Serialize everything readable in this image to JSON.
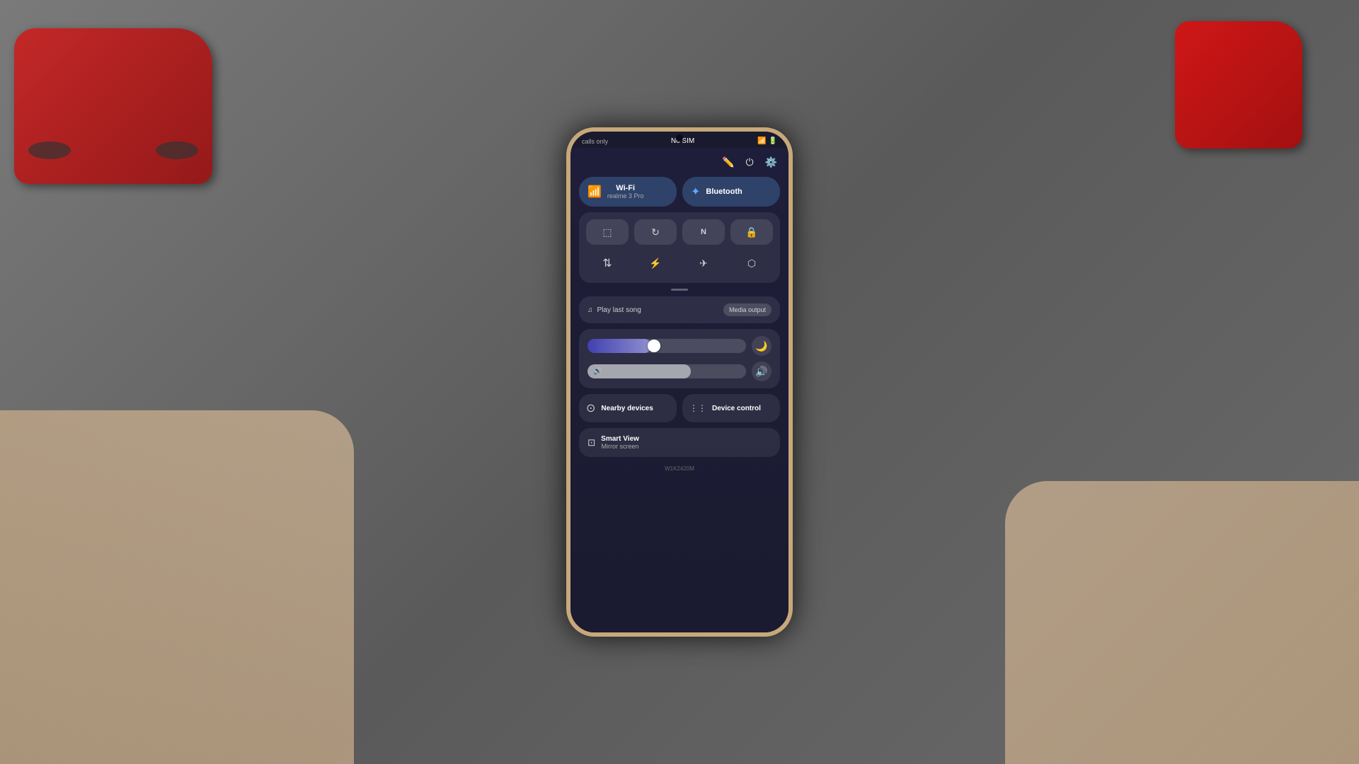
{
  "background": {
    "color": "#5a5a5a"
  },
  "phone": {
    "status_bar": {
      "left": "calls only",
      "center": "No SIM",
      "battery": "🔋",
      "signal": "📶"
    },
    "toolbar": {
      "pencil_icon": "✏️",
      "power_icon": "⏻",
      "settings_icon": "⚙️"
    },
    "wifi_toggle": {
      "label": "Wi-Fi",
      "sub": "realme 3 Pro",
      "icon": "📶"
    },
    "bluetooth_toggle": {
      "label": "Bluetooth",
      "icon": "🔷"
    },
    "icon_grid": {
      "row1": [
        {
          "name": "screenshot",
          "icon": "⬜"
        },
        {
          "name": "rotation",
          "icon": "↻"
        },
        {
          "name": "nfc",
          "icon": "N"
        },
        {
          "name": "screen-lock",
          "icon": "🔒"
        }
      ],
      "row2": [
        {
          "name": "data-sync",
          "icon": "⇅"
        },
        {
          "name": "flashlight",
          "icon": "🔦"
        },
        {
          "name": "airplane",
          "icon": "✈"
        },
        {
          "name": "battery-saver",
          "icon": "🔋"
        }
      ]
    },
    "media": {
      "label": "Play last song",
      "icon": "♫",
      "output_button": "Media output"
    },
    "brightness": {
      "icon": "☀",
      "fill_percent": 40
    },
    "volume": {
      "icon": "🔊",
      "fill_percent": 65
    },
    "night_mode": {
      "icon": "🌙"
    },
    "nearby_devices": {
      "label": "Nearby devices",
      "icon": "⊙"
    },
    "device_control": {
      "label": "Device control",
      "icon": "⋮⋮"
    },
    "smart_view": {
      "label": "Smart View",
      "sub": "Mirror screen",
      "icon": "⊡"
    },
    "bottom_bar": {
      "text": "W1K2420M"
    }
  }
}
